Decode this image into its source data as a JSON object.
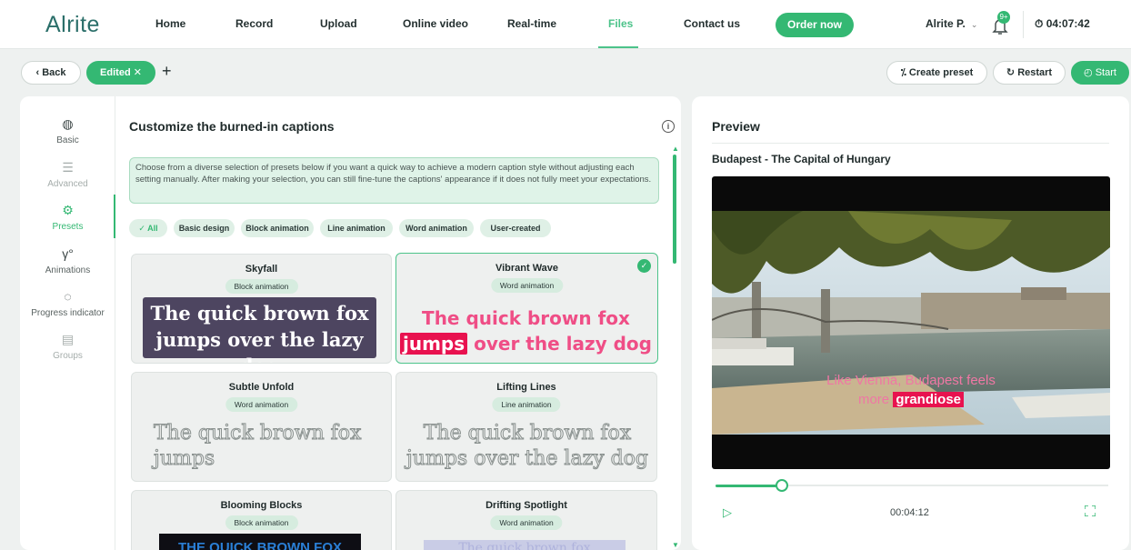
{
  "app": {
    "logo": "Alrite"
  },
  "nav": {
    "items": [
      "Home",
      "Record",
      "Upload",
      "Online video",
      "Real-time",
      "Files",
      "Contact us"
    ],
    "active": "Files",
    "order_label": "Order now",
    "user_label": "Alrite P.",
    "notification_badge": "9+",
    "timer": "04:07:42"
  },
  "toolbar": {
    "back_label": "Back",
    "edited_label": "Edited",
    "add_label": "+",
    "create_preset_label": "Create preset",
    "restart_label": "Restart",
    "start_label": "Start"
  },
  "sidebar": {
    "items": [
      {
        "label": "Basic",
        "icon": "palette-icon",
        "state": "normal"
      },
      {
        "label": "Advanced",
        "icon": "sliders-icon",
        "state": "muted"
      },
      {
        "label": "Presets",
        "icon": "gear-icon",
        "state": "active"
      },
      {
        "label": "Animations",
        "icon": "motion-path-icon",
        "state": "normal"
      },
      {
        "label": "Progress indicator",
        "icon": "progress-icon",
        "state": "normal"
      },
      {
        "label": "Groups",
        "icon": "groups-icon",
        "state": "muted"
      }
    ]
  },
  "editor": {
    "title": "Customize the burned-in captions",
    "info_text": "Choose from a diverse selection of presets below if you want a quick way to achieve a modern caption style without adjusting each setting manually. After making your selection, you can still fine-tune the captions' appearance if it does not fully meet your expectations.",
    "filters": [
      "All",
      "Basic design",
      "Block animation",
      "Line animation",
      "Word animation",
      "User-created"
    ],
    "active_filter": "All",
    "presets": [
      {
        "name": "Skyfall",
        "type": "Block animation",
        "sample": "The quick brown fox jumps over the lazy dog",
        "selected": false
      },
      {
        "name": "Vibrant Wave",
        "type": "Word animation",
        "sample_pre": "The quick brown fox",
        "sample_hl": "jumps",
        "sample_post": "over the lazy dog",
        "selected": true
      },
      {
        "name": "Subtle Unfold",
        "type": "Word animation",
        "sample": "The quick brown fox jumps",
        "selected": false
      },
      {
        "name": "Lifting Lines",
        "type": "Line animation",
        "sample": "The quick brown fox jumps over the lazy dog",
        "selected": false
      },
      {
        "name": "Blooming Blocks",
        "type": "Block animation",
        "sample": "THE QUICK BROWN FOX",
        "selected": false
      },
      {
        "name": "Drifting Spotlight",
        "type": "Word animation",
        "sample": "The quick brown fox",
        "selected": false
      }
    ]
  },
  "preview": {
    "title": "Preview",
    "video_title": "Budapest - The Capital of Hungary",
    "caption_line1": "Like Vienna, Budapest feels",
    "caption_pre": "more",
    "caption_hl": "grandiose",
    "timecode": "00:04:12",
    "progress": 0.17
  },
  "colors": {
    "accent": "#34b873",
    "highlight": "#e8124f",
    "caption_pink": "#ef4e86"
  }
}
